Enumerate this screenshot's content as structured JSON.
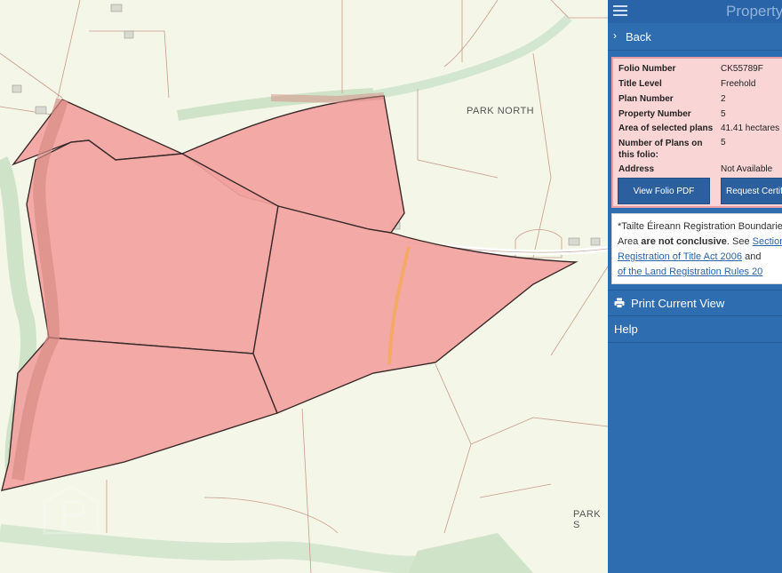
{
  "map": {
    "place_labels": [
      "PARK NORTH",
      "PARK S"
    ]
  },
  "panel": {
    "title": "Property",
    "back_label": "Back",
    "folio": {
      "rows": [
        {
          "label": "Folio Number",
          "value": "CK55789F"
        },
        {
          "label": "Title Level",
          "value": "Freehold"
        },
        {
          "label": "Plan Number",
          "value": "2"
        },
        {
          "label": "Property Number",
          "value": "5"
        },
        {
          "label": "Area of selected plans",
          "value": "41.41 hectares"
        },
        {
          "label": "Number of Plans on this folio:",
          "value": "5"
        },
        {
          "label": "Address",
          "value": "Not Available"
        }
      ],
      "view_pdf_button": "View Folio PDF",
      "request_cert_button": "Request Certif"
    },
    "disclaimer": {
      "line1": "*Tailte Éireann Registration Boundaries",
      "line2_prefix": "Area ",
      "line2_bold": "are not conclusive",
      "line2_suffix": ". See ",
      "line2_link": "Section",
      "line3_link": "Registration of Title Act 2006",
      "line3_suffix": " and ",
      "line4_link": "of the Land Registration Rules 20"
    },
    "print_label": "Print Current View",
    "help_label": "Help"
  },
  "colors": {
    "parcel_fill": "#f2a39f",
    "panel_blue": "#2d6db0",
    "info_bg": "#fad5d6"
  },
  "icons": [
    "hamburger-icon",
    "chevron-right-icon",
    "printer-icon"
  ]
}
